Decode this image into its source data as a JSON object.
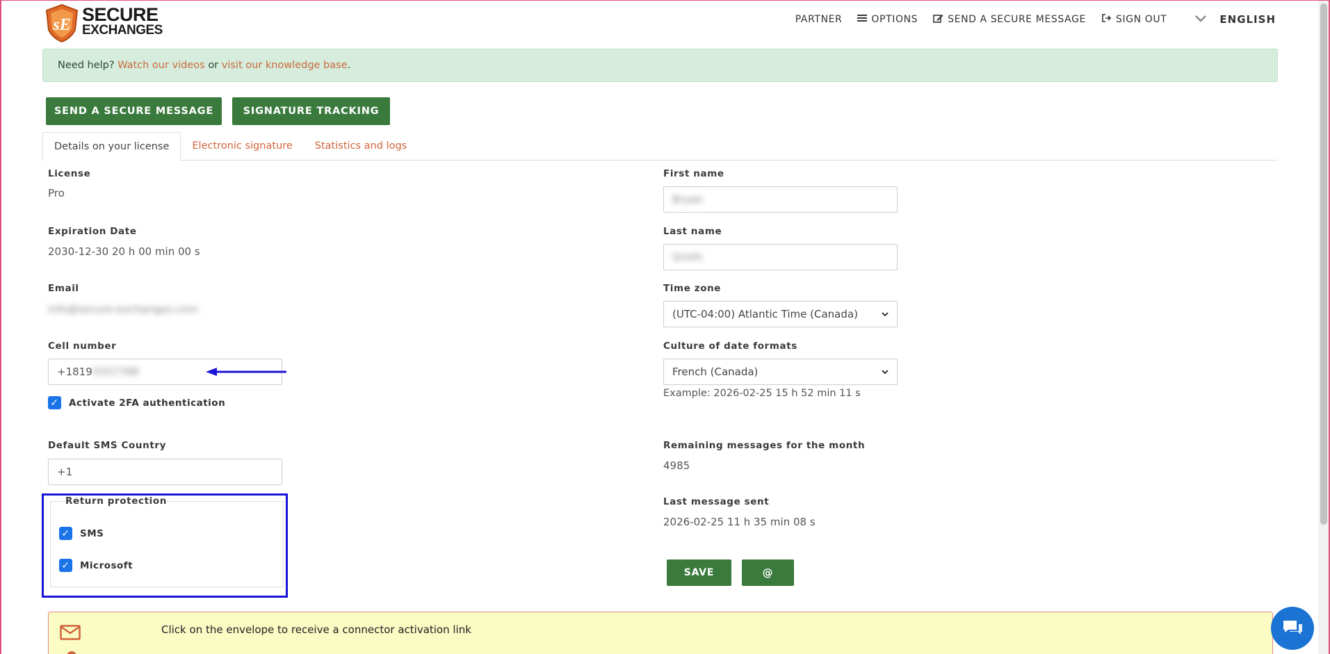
{
  "brand": {
    "line1": "SECURE",
    "line2": "EXCHANGES"
  },
  "nav": {
    "partner": "PARTNER",
    "options": "OPTIONS",
    "send": "SEND A SECURE MESSAGE",
    "signout": "SIGN OUT",
    "language": "ENGLISH"
  },
  "help": {
    "prefix": "Need help? ",
    "videos": "Watch our videos",
    "or": " or ",
    "kb": "visit our knowledge base",
    "suffix": "."
  },
  "actions": {
    "send": "SEND A SECURE MESSAGE",
    "signature": "SIGNATURE TRACKING"
  },
  "tabs": [
    "Details on your license",
    "Electronic signature",
    "Statistics and logs"
  ],
  "left": {
    "license_label": "License",
    "license_value": "Pro",
    "expiration_label": "Expiration Date",
    "expiration_value": "2030-12-30 20 h 00 min 00 s",
    "email_label": "Email",
    "email_value": "info@secure-exchanges.com",
    "cell_label": "Cell number",
    "cell_value": "+1819",
    "cell_hidden": "5557788",
    "twofa_label": "Activate 2FA authentication",
    "sms_country_label": "Default SMS Country",
    "sms_country_value": "+1",
    "return_protection_label": "Return protection",
    "rp_sms": "SMS",
    "rp_microsoft": "Microsoft"
  },
  "right": {
    "first_name_label": "First name",
    "first_name_value": "Bryan",
    "last_name_label": "Last name",
    "last_name_value": "Smith",
    "timezone_label": "Time zone",
    "timezone_value": "(UTC-04:00) Atlantic Time (Canada)",
    "culture_label": "Culture of date formats",
    "culture_value": "French (Canada)",
    "culture_example": "Example: 2026-02-25 15 h 52 min 11 s",
    "remaining_label": "Remaining messages for the month",
    "remaining_value": "4985",
    "last_sent_label": "Last message sent",
    "last_sent_value": "2026-02-25 11 h 35 min 08 s",
    "save": "SAVE",
    "at": "@"
  },
  "connector": {
    "text": "Click on the envelope to receive a connector activation link"
  },
  "colors": {
    "green": "#3a7a3c",
    "accent": "#d1633a",
    "annotation": "#1a14d6"
  }
}
